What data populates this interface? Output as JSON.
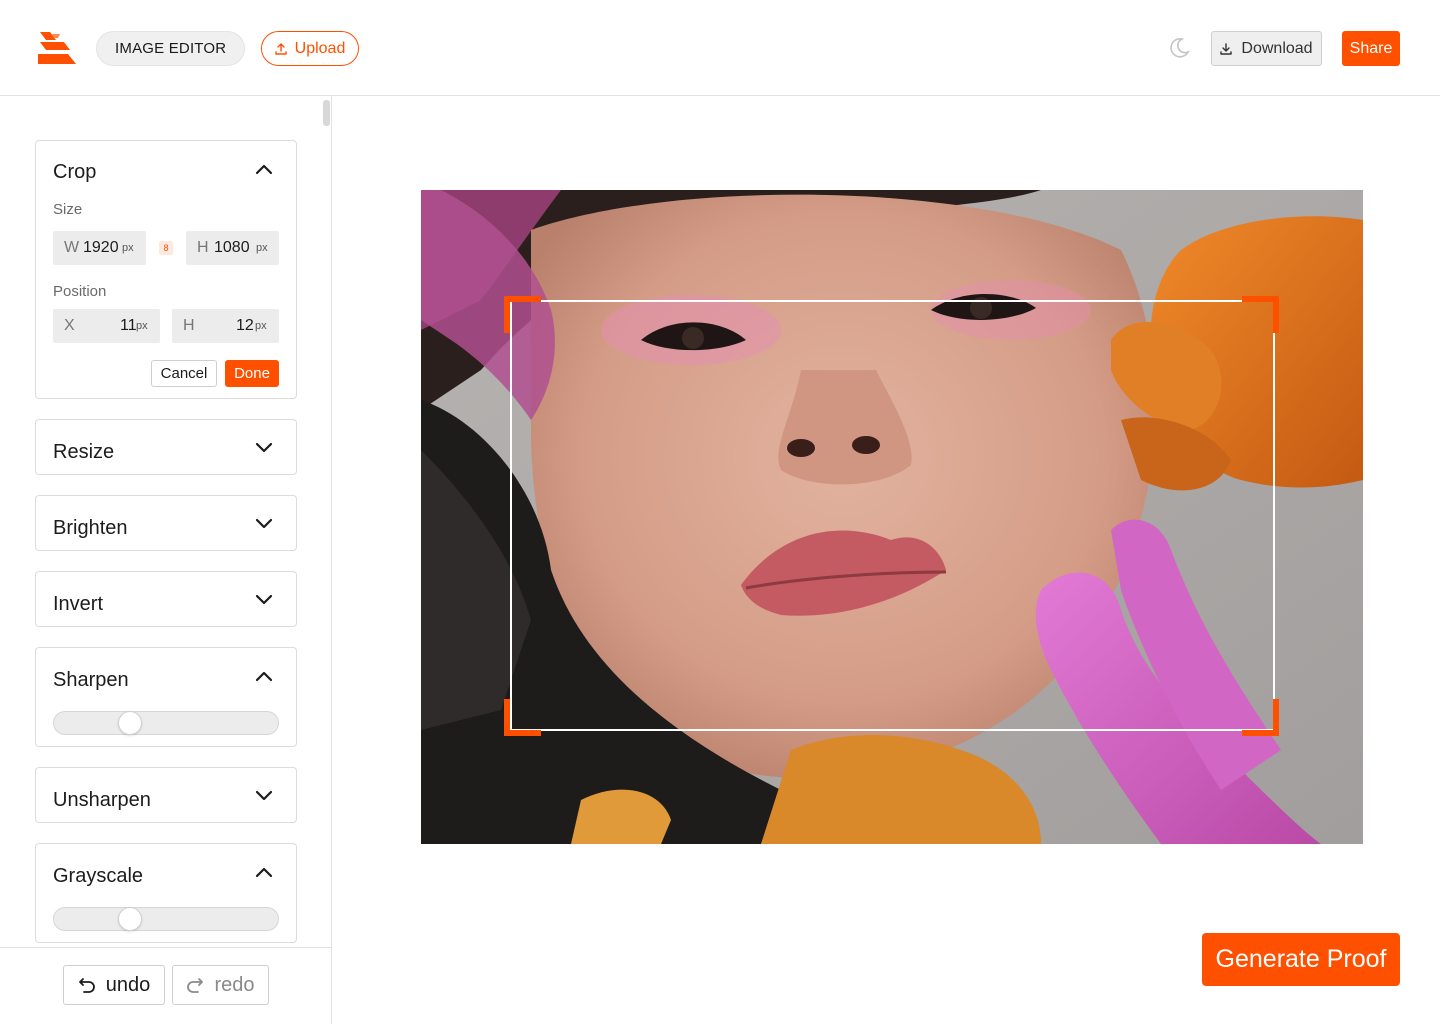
{
  "header": {
    "app_title": "IMAGE EDITOR",
    "upload_label": "Upload",
    "download_label": "Download",
    "share_label": "Share",
    "theme_icon": "moon-icon"
  },
  "colors": {
    "accent": "#ff5000",
    "field_bg": "#ececec",
    "border": "#dcdcdc"
  },
  "sidebar": {
    "crop": {
      "title": "Crop",
      "expanded": true,
      "size_label": "Size",
      "width": {
        "prefix": "W",
        "value": "1920",
        "unit": "px"
      },
      "height": {
        "prefix": "H",
        "value": "1080",
        "unit": "px"
      },
      "link_glyph": "8",
      "position_label": "Position",
      "pos_x": {
        "prefix": "X",
        "value": "11",
        "unit": "px"
      },
      "pos_h": {
        "prefix": "H",
        "value": "12",
        "unit": "px"
      },
      "cancel_label": "Cancel",
      "done_label": "Done"
    },
    "resize": {
      "title": "Resize",
      "expanded": false
    },
    "brighten": {
      "title": "Brighten",
      "expanded": false
    },
    "invert": {
      "title": "Invert",
      "expanded": false
    },
    "sharpen": {
      "title": "Sharpen",
      "expanded": true,
      "level": 0.32
    },
    "unsharpen": {
      "title": "Unsharpen",
      "expanded": false
    },
    "grayscale": {
      "title": "Grayscale",
      "expanded": true,
      "level": 0.32
    }
  },
  "history": {
    "undo_label": "undo",
    "redo_label": "redo"
  },
  "main": {
    "generate_label": "Generate Proof"
  }
}
